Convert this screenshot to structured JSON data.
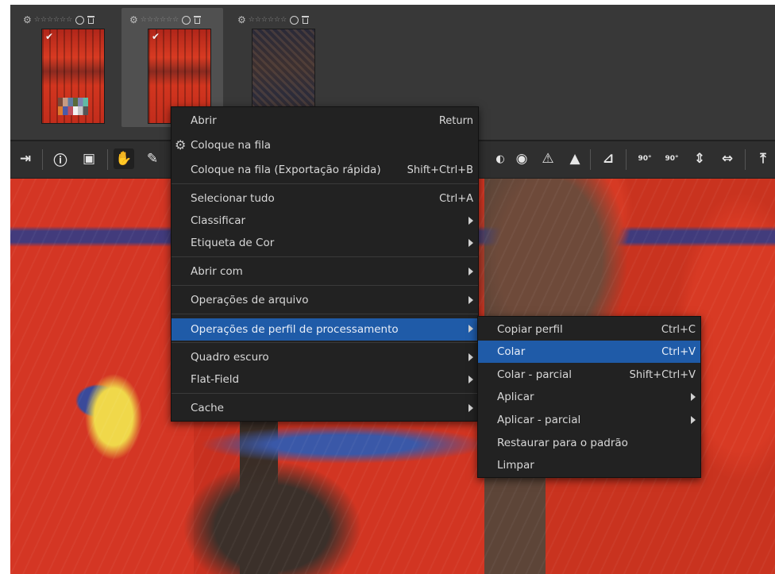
{
  "thumbnails": [
    {
      "stars": "☆☆☆☆☆☆",
      "selected": false,
      "checked": true
    },
    {
      "stars": "☆☆☆☆☆☆",
      "selected": true,
      "checked": true
    },
    {
      "stars": "☆☆☆☆☆☆",
      "selected": false,
      "checked": false
    }
  ],
  "context_menu": {
    "items": [
      {
        "label": "Abrir",
        "accel": "Return"
      },
      {
        "label": "Coloque na fila",
        "accel": ""
      },
      {
        "label": "Coloque na fila (Exportação rápida)",
        "accel": "Shift+Ctrl+B"
      },
      {
        "label": "Selecionar tudo",
        "accel": "Ctrl+A"
      },
      {
        "label": "Classificar",
        "accel": ""
      },
      {
        "label": "Etiqueta de Cor",
        "accel": ""
      },
      {
        "label": "Abrir com",
        "accel": ""
      },
      {
        "label": "Operações de arquivo",
        "accel": ""
      },
      {
        "label": "Operações de perfil de processamento",
        "accel": ""
      },
      {
        "label": "Quadro escuro",
        "accel": ""
      },
      {
        "label": "Flat-Field",
        "accel": ""
      },
      {
        "label": "Cache",
        "accel": ""
      }
    ]
  },
  "submenu": {
    "items": [
      {
        "label": "Copiar perfil",
        "accel": "Ctrl+C"
      },
      {
        "label": "Colar",
        "accel": "Ctrl+V"
      },
      {
        "label": "Colar - parcial",
        "accel": "Shift+Ctrl+V"
      },
      {
        "label": "Aplicar",
        "accel": ""
      },
      {
        "label": "Aplicar - parcial",
        "accel": ""
      },
      {
        "label": "Restaurar para o padrão",
        "accel": ""
      },
      {
        "label": "Limpar",
        "accel": ""
      }
    ]
  },
  "toolbar": {
    "rotate_ccw": "90°",
    "rotate_cw": "90°"
  },
  "colors": {
    "menu_bg": "#222222",
    "highlight": "#1f5ba8",
    "filmstrip_bg": "#383838"
  }
}
